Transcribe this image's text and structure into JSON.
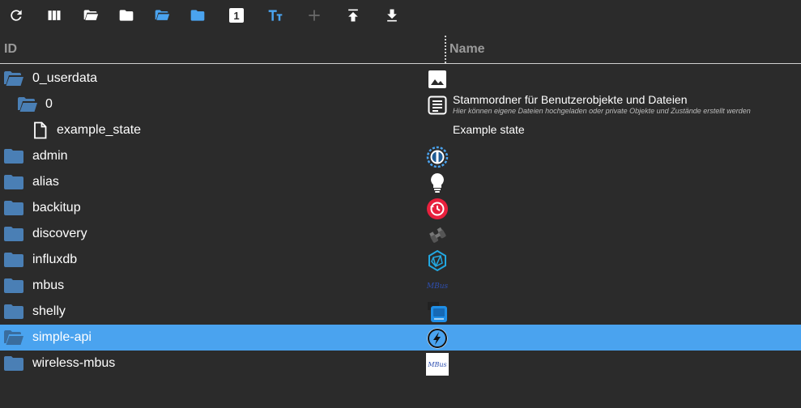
{
  "toolbar": {
    "buttons": [
      {
        "name": "refresh",
        "icon": "refresh-icon"
      },
      {
        "name": "columns",
        "icon": "columns-icon"
      },
      {
        "name": "expand-all",
        "icon": "folder-open-icon"
      },
      {
        "name": "collapse-all",
        "icon": "folder-icon"
      },
      {
        "name": "expand-one",
        "icon": "folder-open-blue-icon"
      },
      {
        "name": "collapse-one",
        "icon": "folder-blue-icon"
      },
      {
        "name": "counter",
        "icon": "counter-icon",
        "label": "1"
      },
      {
        "name": "text-size",
        "icon": "text-size-icon"
      },
      {
        "name": "add",
        "icon": "plus-icon"
      },
      {
        "name": "upload",
        "icon": "upload-icon"
      },
      {
        "name": "download",
        "icon": "download-icon"
      }
    ]
  },
  "header": {
    "id_label": "ID",
    "name_label": "Name"
  },
  "rows": [
    {
      "label": "0_userdata",
      "type": "folder-open",
      "indent": 0,
      "name_icon": "image-icon",
      "name": "",
      "desc": ""
    },
    {
      "label": "0",
      "type": "folder-open",
      "indent": 1,
      "name_icon": "document-icon",
      "name": "Stammordner für Benutzerobjekte und Dateien",
      "desc": "Hier können eigene Dateien hochgeladen oder private Objekte und Zustände erstellt werden"
    },
    {
      "label": "example_state",
      "type": "file",
      "indent": 2,
      "name_icon": "",
      "name": "Example state",
      "desc": ""
    },
    {
      "label": "admin",
      "type": "folder",
      "indent": 0,
      "name_icon": "admin-icon",
      "name": "",
      "desc": ""
    },
    {
      "label": "alias",
      "type": "folder",
      "indent": 0,
      "name_icon": "lightbulb-icon",
      "name": "",
      "desc": ""
    },
    {
      "label": "backitup",
      "type": "folder",
      "indent": 0,
      "name_icon": "backitup-icon",
      "name": "",
      "desc": ""
    },
    {
      "label": "discovery",
      "type": "folder",
      "indent": 0,
      "name_icon": "binoculars-icon",
      "name": "",
      "desc": ""
    },
    {
      "label": "influxdb",
      "type": "folder",
      "indent": 0,
      "name_icon": "influxdb-icon",
      "name": "",
      "desc": ""
    },
    {
      "label": "mbus",
      "type": "folder",
      "indent": 0,
      "name_icon": "mbus-icon",
      "name": "",
      "desc": "",
      "icon_text": "MBus"
    },
    {
      "label": "shelly",
      "type": "folder",
      "indent": 0,
      "name_icon": "shelly-icon",
      "name": "",
      "desc": ""
    },
    {
      "label": "simple-api",
      "type": "folder-open",
      "indent": 0,
      "selected": true,
      "name_icon": "simple-api-icon",
      "name": "",
      "desc": ""
    },
    {
      "label": "wireless-mbus",
      "type": "folder",
      "indent": 0,
      "name_icon": "wireless-mbus-icon",
      "name": "",
      "desc": "",
      "icon_text": "MBus"
    }
  ],
  "colors": {
    "background": "#2b2b2b",
    "selected": "#4aa3ef",
    "folder": "#4a7fb5",
    "accent_blue": "#4aa3ef"
  }
}
